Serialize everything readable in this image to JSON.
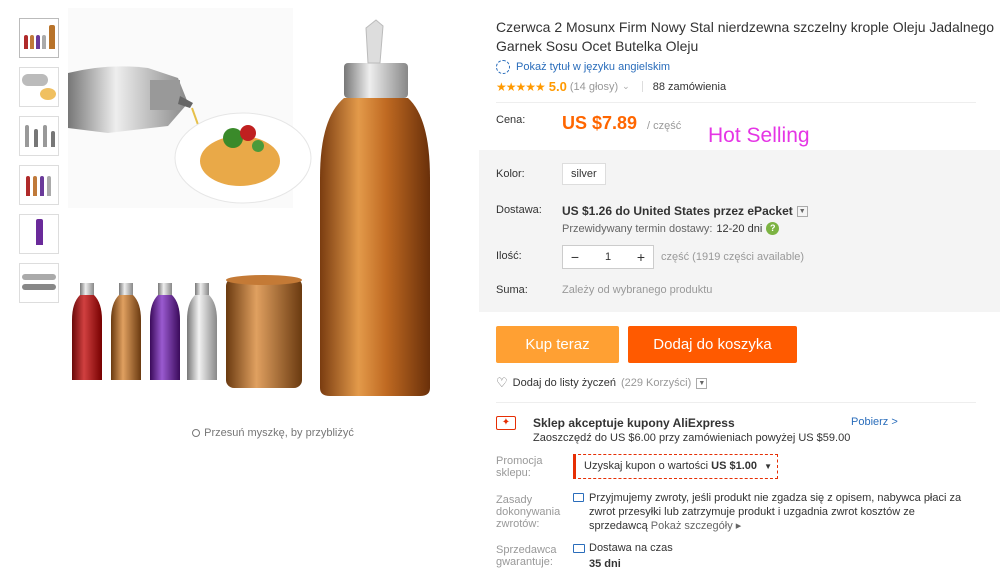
{
  "gallery": {
    "hint": "Przesuń myszkę, by przybliżyć",
    "thumb_count": 6
  },
  "product": {
    "title": "Czerwca 2 Mosunx Firm Nowy Stal nierdzewna szczelny krople Oleju Jadalnego Garnek Sosu Ocet Butelka Oleju",
    "translate_link": "Pokaż tytuł w języku angielskim",
    "stars": "★★★★★",
    "rating": "5.0",
    "votes": "(14 głosy)",
    "orders": "88 zamówienia"
  },
  "price": {
    "label": "Cena:",
    "value": "US $7.89",
    "unit": "/ część",
    "promo_text": "Hot Selling"
  },
  "options": {
    "color_label": "Kolor:",
    "color_value": "silver",
    "shipping_label": "Dostawa:",
    "shipping_text": "US $1.26 do United States przez ePacket",
    "shipping_time_label": "Przewidywany termin dostawy:",
    "shipping_time_value": "12-20 dni",
    "qty_label": "Ilość:",
    "qty_minus": "−",
    "qty_value": "1",
    "qty_plus": "+",
    "qty_note": "część (1919 części available)",
    "sum_label": "Suma:",
    "sum_note": "Zależy od wybranego produktu"
  },
  "actions": {
    "buy_now": "Kup teraz",
    "add_to_cart": "Dodaj do koszyka",
    "wishlist": "Dodaj do listy życzeń",
    "wishlist_count": "(229 Korzyści)"
  },
  "coupon": {
    "icon_text": "✦",
    "title": "Sklep akceptuje kupony AliExpress",
    "subtitle": "Zaoszczędź do US $6.00 przy zamówieniach powyżej US $59.00",
    "get_link": "Pobierz >",
    "promo_label_1": "Promocja",
    "promo_label_2": "sklepu:",
    "promo_value_prefix": "Uzyskaj kupon o wartości",
    "promo_value_amount": "US $1.00"
  },
  "policy": {
    "label_1": "Zasady",
    "label_2": "dokonywania",
    "label_3": "zwrotów:",
    "text": "Przyjmujemy zwroty, jeśli produkt nie zgadza się z opisem, nabywca płaci za zwrot przesyłki lub zatrzymuje produkt i uzgadnia zwrot kosztów ze sprzedawcą",
    "more": "Pokaż szczegóły ▸",
    "guarantee_label_1": "Sprzedawca",
    "guarantee_label_2": "gwarantuje:",
    "guarantee_text": "Dostawa na czas",
    "guarantee_days": "35 dni"
  },
  "colors": {
    "price": "#ff6600",
    "buy_now": "#ffa033",
    "add_to_cart": "#ff5a00",
    "link": "#2a6dbb",
    "promo": "#e535e5"
  }
}
